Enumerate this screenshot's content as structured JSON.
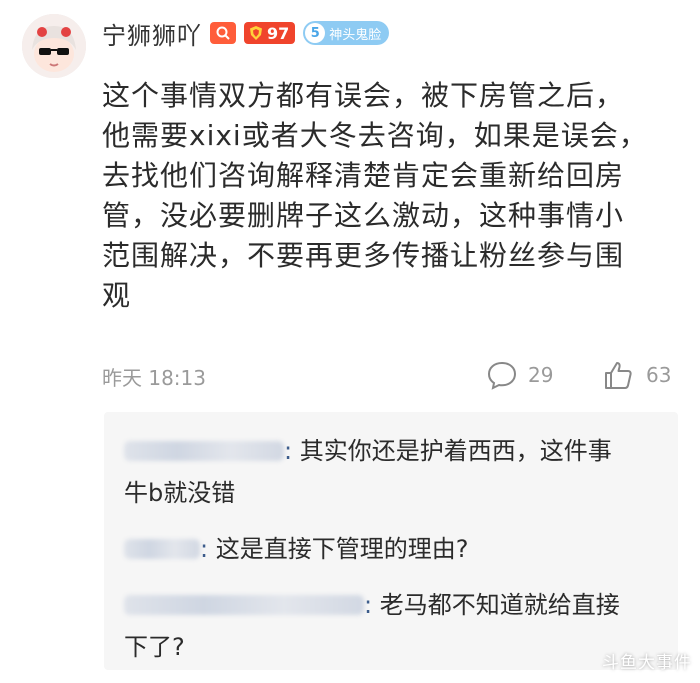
{
  "user": {
    "name": "宁狮狮吖",
    "level": "97",
    "fan_badge_level": "5",
    "fan_badge_name": "神头鬼脸"
  },
  "comment": {
    "lines": [
      "这个事情双方都有误会，被下房管之后，",
      "他需要xixi或者大冬去咨询，如果是误会，",
      "去找他们咨询解释清楚肯定会重新给回房",
      "管，没必要删牌子这么激动，这种事情小",
      "范围解决，不要再更多传播让粉丝参与围",
      "观"
    ],
    "time": "昨天 18:13",
    "reply_count": "29",
    "like_count": "63"
  },
  "replies": [
    {
      "colon": ":",
      "line1": "其实你还是护着西西，这件事",
      "line2": "牛b就没错"
    },
    {
      "colon": ":",
      "line1": "这是直接下管理的理由?",
      "line2": ""
    },
    {
      "colon": ":",
      "line1": "老马都不知道就给直接",
      "line2": "下了?"
    }
  ],
  "watermark": "斗鱼大事件",
  "colors": {
    "level_badge": "#f0442c",
    "fans_badge": "#8ecbf3",
    "reply_bg": "#f6f6f6",
    "meta_gray": "#9a9a9a"
  }
}
